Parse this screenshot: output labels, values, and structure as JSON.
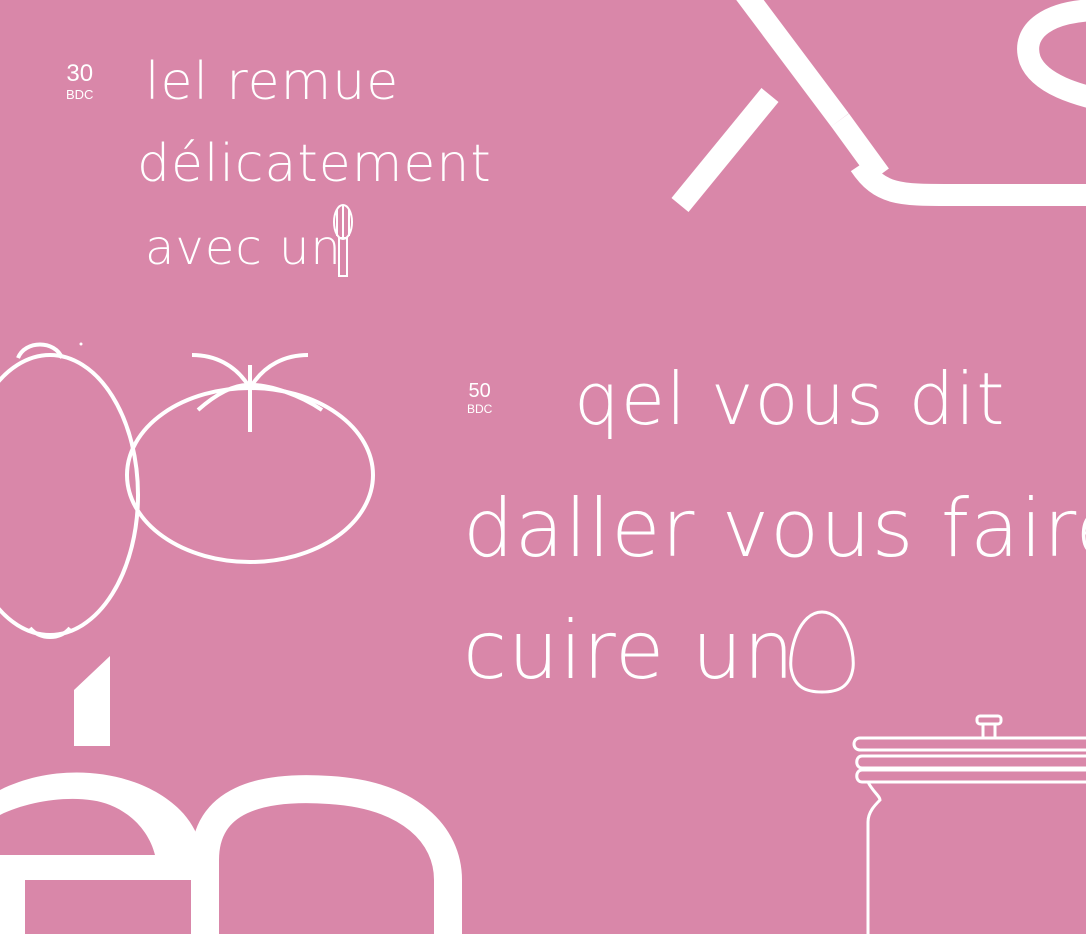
{
  "specimens": [
    {
      "size": {
        "value": "30",
        "unit": "BDC"
      },
      "lines": [
        "lel remue",
        "délicatement",
        "avec un"
      ],
      "inline_icon": "whisk-icon"
    },
    {
      "size": {
        "value": "50",
        "unit": "BDC"
      },
      "lines": [
        "qel vous dit",
        "daller vous faire",
        "cuire un"
      ],
      "inline_icon": "egg-icon"
    }
  ],
  "illustrations": [
    "lemon-icon",
    "tomato-icon",
    "cooking-pot-icon"
  ],
  "colors": {
    "background": "#d987a9",
    "foreground": "#ffffff"
  }
}
